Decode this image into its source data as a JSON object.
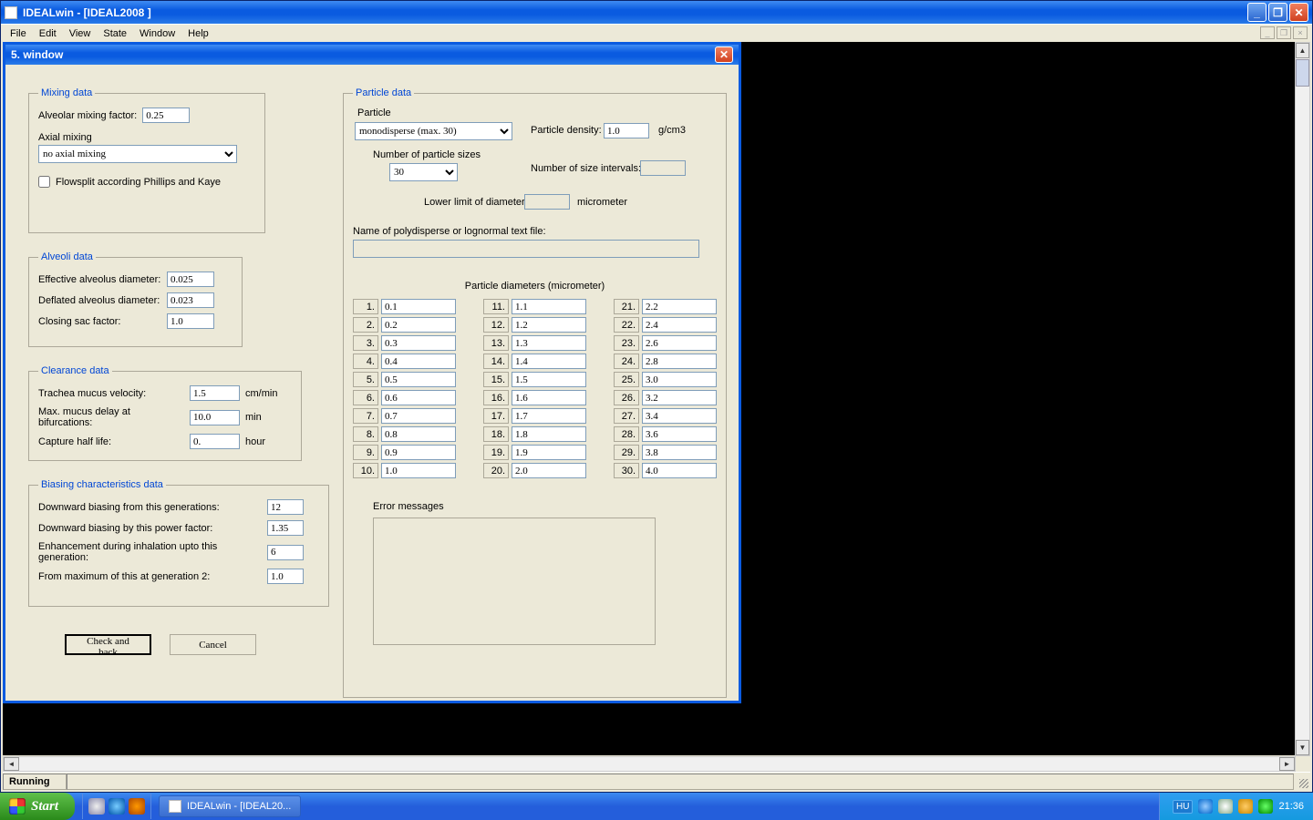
{
  "outer": {
    "title": "IDEALwin - [IDEAL2008  ]",
    "menu": [
      "File",
      "Edit",
      "View",
      "State",
      "Window",
      "Help"
    ],
    "status": "Running"
  },
  "child": {
    "title": "5. window"
  },
  "mixing": {
    "legend": "Mixing data",
    "alv_label": "Alveolar mixing factor:",
    "alv_value": "0.25",
    "axial_label": "Axial mixing",
    "axial_value": "no axial mixing",
    "flowsplit_label": "Flowsplit according Phillips and Kaye"
  },
  "alveoli": {
    "legend": "Alveoli data",
    "eff_label": "Effective alveolus diameter:",
    "eff_value": "0.025",
    "def_label": "Deflated alveolus diameter:",
    "def_value": "0.023",
    "close_label": "Closing sac factor:",
    "close_value": "1.0"
  },
  "clearance": {
    "legend": "Clearance data",
    "trach_label": "Trachea mucus velocity:",
    "trach_value": "1.5",
    "trach_unit": "cm/min",
    "maxm_label": "Max. mucus delay at bifurcations:",
    "maxm_value": "10.0",
    "maxm_unit": "min",
    "cap_label": "Capture half life:",
    "cap_value": "0.",
    "cap_unit": "hour"
  },
  "biasing": {
    "legend": "Biasing characteristics data",
    "down_gen_label": "Downward biasing from this generations:",
    "down_gen_value": "12",
    "down_pow_label": "Downward biasing by this power factor:",
    "down_pow_value": "1.35",
    "enh_label": "Enhancement during inhalation upto this generation:",
    "enh_value": "6",
    "max2_label": "From maximum of this at generation 2:",
    "max2_value": "1.0"
  },
  "particle": {
    "legend": "Particle data",
    "particle_label": "Particle",
    "particle_value": "monodisperse (max. 30)",
    "density_label": "Particle density:",
    "density_value": "1.0",
    "density_unit": "g/cm3",
    "nsizes_label": "Number of particle sizes",
    "nsizes_value": "30",
    "nintervals_label": "Number of size intervals:",
    "nintervals_value": "",
    "lowlim_label": "Lower limit of diameter:",
    "lowlim_value": "",
    "lowlim_unit": "micrometer",
    "polyfile_label": "Name of polydisperse or lognormal text file:",
    "polyfile_value": "",
    "diam_header": "Particle diameters (micrometer)",
    "diameters": [
      {
        "i": "1.",
        "v": "0.1"
      },
      {
        "i": "2.",
        "v": "0.2"
      },
      {
        "i": "3.",
        "v": "0.3"
      },
      {
        "i": "4.",
        "v": "0.4"
      },
      {
        "i": "5.",
        "v": "0.5"
      },
      {
        "i": "6.",
        "v": "0.6"
      },
      {
        "i": "7.",
        "v": "0.7"
      },
      {
        "i": "8.",
        "v": "0.8"
      },
      {
        "i": "9.",
        "v": "0.9"
      },
      {
        "i": "10.",
        "v": "1.0"
      },
      {
        "i": "11.",
        "v": "1.1"
      },
      {
        "i": "12.",
        "v": "1.2"
      },
      {
        "i": "13.",
        "v": "1.3"
      },
      {
        "i": "14.",
        "v": "1.4"
      },
      {
        "i": "15.",
        "v": "1.5"
      },
      {
        "i": "16.",
        "v": "1.6"
      },
      {
        "i": "17.",
        "v": "1.7"
      },
      {
        "i": "18.",
        "v": "1.8"
      },
      {
        "i": "19.",
        "v": "1.9"
      },
      {
        "i": "20.",
        "v": "2.0"
      },
      {
        "i": "21.",
        "v": "2.2"
      },
      {
        "i": "22.",
        "v": "2.4"
      },
      {
        "i": "23.",
        "v": "2.6"
      },
      {
        "i": "24.",
        "v": "2.8"
      },
      {
        "i": "25.",
        "v": "3.0"
      },
      {
        "i": "26.",
        "v": "3.2"
      },
      {
        "i": "27.",
        "v": "3.4"
      },
      {
        "i": "28.",
        "v": "3.6"
      },
      {
        "i": "29.",
        "v": "3.8"
      },
      {
        "i": "30.",
        "v": "4.0"
      }
    ],
    "err_label": "Error messages"
  },
  "buttons": {
    "check": "Check and back",
    "cancel": "Cancel"
  },
  "taskbar": {
    "start": "Start",
    "task": "IDEALwin - [IDEAL20...",
    "lang": "HU",
    "clock": "21:36"
  }
}
